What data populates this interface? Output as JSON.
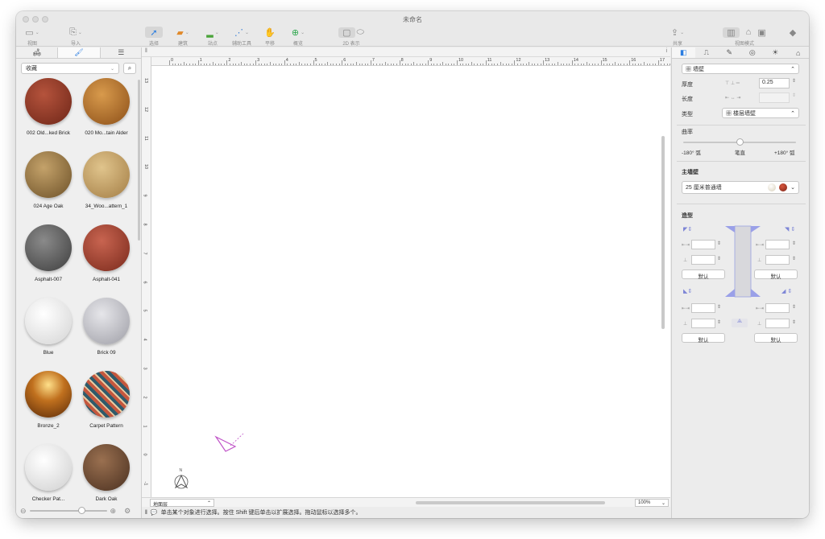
{
  "window": {
    "title": "未命名"
  },
  "toolbar": {
    "view_label": "视图",
    "import_label": "导入",
    "select_label": "选择",
    "build_label": "建筑",
    "terrain_label": "站点",
    "guides_label": "辅助工具",
    "pan_label": "平移",
    "zoom_label": "概览",
    "display2d_label": "2D 表示",
    "share_label": "共享",
    "viewmode_label": "视图模式"
  },
  "left": {
    "collection_select": "收藏",
    "materials": [
      {
        "name": "002 Old...ked Brick",
        "color": "#8e3a28"
      },
      {
        "name": "020 Mo...tain Alder",
        "color": "#b46a2a"
      },
      {
        "name": "024 Age Oak",
        "color": "#9a7a45"
      },
      {
        "name": "34_Woo...attern_1",
        "color": "#c3a06b"
      },
      {
        "name": "Asphalt-007",
        "color": "#5e5e5e"
      },
      {
        "name": "Asphalt-041",
        "color": "#a2412f"
      },
      {
        "name": "Blue",
        "color": "#eaeaea"
      },
      {
        "name": "Brick 09",
        "color": "#c7c7cc"
      },
      {
        "name": "Bronze_2",
        "color": "#9a5a1a"
      },
      {
        "name": "Carpet Pattern",
        "color": "#9c4a3a"
      },
      {
        "name": "Checker Pat...",
        "color": "#e9e9e9"
      },
      {
        "name": "Dark Oak",
        "color": "#6b4a30"
      }
    ]
  },
  "canvas": {
    "ruler_unit": "m",
    "h_ticks": [
      "0",
      "1",
      "2",
      "3",
      "4",
      "5",
      "6",
      "7",
      "8",
      "9",
      "10",
      "11",
      "12",
      "13",
      "14",
      "15",
      "16",
      "17"
    ],
    "v_ticks": [
      "13",
      "12",
      "11",
      "10",
      "9",
      "8",
      "7",
      "6",
      "5",
      "4",
      "3",
      "2",
      "1",
      "0",
      "-1"
    ],
    "layer_select": "地面层",
    "zoom_select": "100%"
  },
  "status": {
    "text": "单击某个对象进行选择。按住 Shift 键后单击以扩展选择。拖动鼠标以选择多个。"
  },
  "inspector": {
    "type_select": "墙壁",
    "thickness_label": "厚度",
    "thickness_value": "0.25",
    "length_label": "长度",
    "kind_label": "类型",
    "kind_select": "楼层墙壁",
    "curvature_label": "曲率",
    "curve_min": "-180° 弧",
    "curve_mid": "笔直",
    "curve_max": "+180° 弧",
    "main_wall_label": "主墙壁",
    "main_wall_select": "25 厘米普通墙",
    "profile_label": "造型",
    "default_label": "默认"
  }
}
